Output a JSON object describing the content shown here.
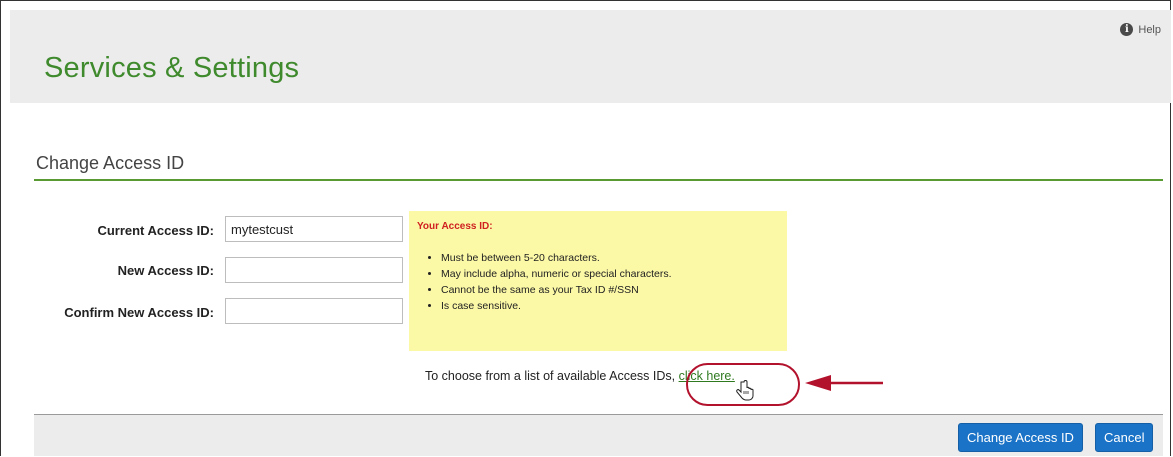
{
  "header": {
    "help_label": "Help",
    "title": "Services & Settings"
  },
  "section": {
    "title": "Change Access ID"
  },
  "form": {
    "current_label": "Current Access ID:",
    "current_value": "mytestcust",
    "new_label": "New Access ID:",
    "new_value": "",
    "confirm_label": "Confirm New Access ID:",
    "confirm_value": ""
  },
  "rules": {
    "title": "Your Access ID:",
    "items": [
      "Must be between 5-20 characters.",
      "May include alpha, numeric or special characters.",
      "Cannot be the same as your Tax ID #/SSN",
      "Is case sensitive."
    ]
  },
  "choose": {
    "prefix": "To choose from a list of available Access IDs, ",
    "link": "click here."
  },
  "footer": {
    "submit_label": "Change Access ID",
    "cancel_label": "Cancel"
  },
  "colors": {
    "brand_green": "#3f8a2d",
    "button_blue": "#1a73c7",
    "highlight_red": "#b3122d",
    "note_yellow": "#fbf8a6"
  }
}
